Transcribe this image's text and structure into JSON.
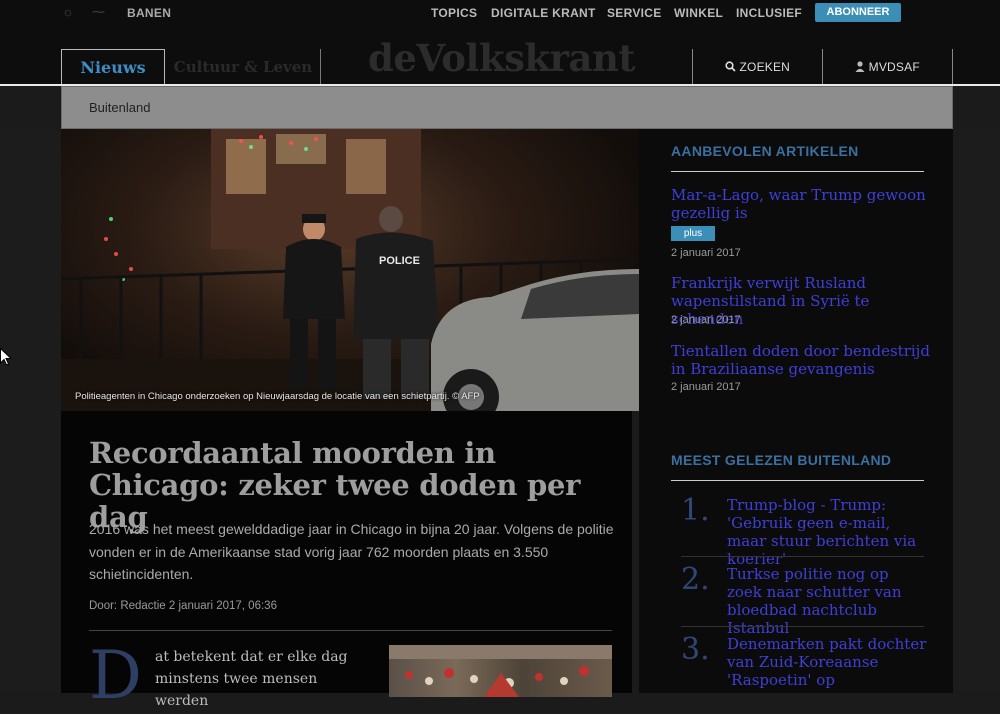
{
  "topbar": {
    "left_link": "BANEN",
    "nav": [
      "TOPICS",
      "DIGITALE KRANT",
      "SERVICE",
      "WINKEL",
      "INCLUSIEF"
    ],
    "subscribe": "ABONNEER"
  },
  "header": {
    "tab_active": "Nieuws",
    "tab_other": "Cultuur & Leven",
    "logo": "deVolkskrant",
    "search": "ZOEKEN",
    "user": "MVDSAF"
  },
  "section": "Buitenland",
  "hero": {
    "caption": "Politieagenten in Chicago onderzoeken op Nieuwjaarsdag de locatie van een schietpartij. © AFP",
    "badge_text": "POLICE"
  },
  "article": {
    "title": "Recordaantal moorden in Chicago: zeker twee doden per dag",
    "lead": "2016 was het meest gewelddadige jaar in Chicago in bijna 20 jaar. Volgens de politie vonden er in de Amerikaanse stad vorig jaar 762 moorden plaats en 3.550 schietincidenten.",
    "byline": "Door: Redactie 2 januari 2017, 06:36",
    "dropcap": "D",
    "body_start": "at betekent dat er elke dag minstens twee mensen werden"
  },
  "sidebar": {
    "recommended_heading": "AANBEVOLEN ARTIKELEN",
    "recommended": [
      {
        "title": "Mar-a-Lago, waar Trump gewoon gezellig is",
        "badge": "plus",
        "date": "2 januari 2017"
      },
      {
        "title": "Frankrijk verwijt Rusland wapenstilstand in Syrië te schenden",
        "date": "2 januari 2017"
      },
      {
        "title": "Tientallen doden door bendestrijd in Braziliaanse gevangenis",
        "date": "2 januari 2017"
      }
    ],
    "most_read_heading": "MEEST GELEZEN BUITENLAND",
    "most_read": [
      {
        "num": "1.",
        "title": "Trump-blog - Trump: 'Gebruik geen e-mail, maar stuur berichten via koerier'"
      },
      {
        "num": "2.",
        "title": "Turkse politie nog op zoek naar schutter van bloedbad nachtclub Istanbul"
      },
      {
        "num": "3.",
        "title": "Denemarken pakt dochter van Zuid-Koreaanse 'Raspoetin' op"
      }
    ]
  },
  "colors": {
    "accent": "#3b8fb6",
    "link": "#3f3fd8",
    "heading": "#3a6fa0"
  }
}
